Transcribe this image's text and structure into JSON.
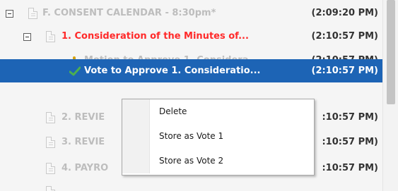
{
  "tree": {
    "rows": [
      {
        "label": "F. CONSENT CALENDAR - 8:30pm*",
        "time": "(2:09:20 PM)"
      },
      {
        "label": "1. Consideration of the Minutes of...",
        "time": "(2:10:57 PM)"
      },
      {
        "label": "Motion to Approve 1. Considera...",
        "time": "(2:10:57 PM)"
      },
      {
        "label": "Vote to Approve 1. Consideratio...",
        "time": "(2:10:57 PM)"
      },
      {
        "label": "2. REVIE",
        "time": ":10:57 PM)"
      },
      {
        "label": "3. REVIE",
        "time": ":10:57 PM)"
      },
      {
        "label": "4. PAYRO",
        "time": ":10:57 PM)"
      }
    ]
  },
  "context_menu": {
    "items": [
      "Delete",
      "Store as Vote 1",
      "Store as Vote 2"
    ]
  },
  "colors": {
    "selection": "#1d64b5",
    "red_item": "#ff2a2a",
    "grey_item": "#bdbdbd",
    "motion_icon": "#d7a20e",
    "check_icon": "#4caf50"
  }
}
